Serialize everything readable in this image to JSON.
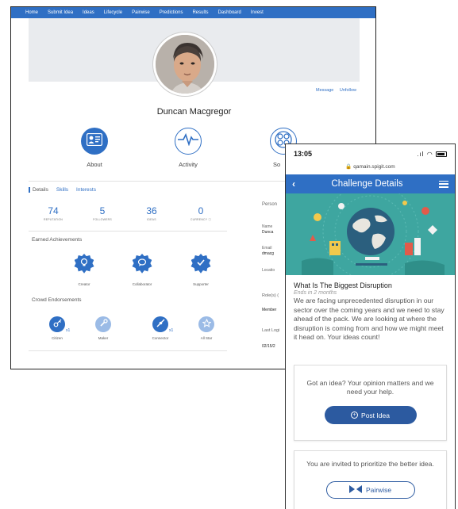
{
  "desktop": {
    "nav": [
      "Home",
      "Submit Idea",
      "Ideas",
      "Lifecycle",
      "Pairwise",
      "Predictions",
      "Results",
      "Dashboard",
      "Invest"
    ],
    "profile": {
      "name": "Duncan Macgregor",
      "message_label": "Message",
      "unfollow_label": "Unfollow"
    },
    "big_tabs": [
      {
        "label": "About",
        "icon": "id-card-icon"
      },
      {
        "label": "Activity",
        "icon": "activity-pulse-icon"
      },
      {
        "label": "So",
        "icon": "social-network-icon"
      }
    ],
    "detail_tabs": [
      "Details",
      "Skills",
      "Interests"
    ],
    "stats": [
      {
        "value": "74",
        "label": "REPUTATION"
      },
      {
        "value": "5",
        "label": "FOLLOWERS"
      },
      {
        "value": "36",
        "label": "IDEAS"
      },
      {
        "value": "0",
        "label": "CURRENCY ⓘ"
      }
    ],
    "achievements_title": "Earned Achievements",
    "achievements": [
      {
        "label": "Creator",
        "icon": "lightbulb-icon"
      },
      {
        "label": "Collaborator",
        "icon": "chat-bubble-icon"
      },
      {
        "label": "Supporter",
        "icon": "checkmark-icon"
      }
    ],
    "endorsements_title": "Crowd Endorsements",
    "endorsements": [
      {
        "label": "Citizen",
        "count": "x1",
        "icon": "key-icon"
      },
      {
        "label": "Maker",
        "count": "",
        "icon": "wrench-icon"
      },
      {
        "label": "Connector",
        "count": "x1",
        "icon": "connector-icon"
      },
      {
        "label": "All Star",
        "count": "",
        "icon": "star-icon"
      }
    ],
    "right_col": {
      "personal": "Person",
      "name_label": "Name",
      "name_value": "Dunca",
      "email_label": "Email",
      "email_value": "dmacg",
      "location_label": "Locatio",
      "roles_label": "Role(s) (",
      "roles_value": "Member",
      "last_login_label": "Last Logi",
      "last_login_value": "02/15/2"
    }
  },
  "phone": {
    "time": "13:05",
    "url": "🔒 qamain.spigit.com",
    "header_title": "Challenge Details",
    "challenge_title": "What Is The Biggest Disruption",
    "ends": "Ends in 2 months",
    "description": "We are facing unprecedented disruption in our sector over the coming years and we need to stay ahead of the pack. We are looking at where the disruption is coming from and how we might meet it head on. Your ideas count!",
    "idea_card": {
      "text": "Got an idea? Your opinion matters and we need your help.",
      "button": "Post Idea"
    },
    "pairwise_card": {
      "text": "You are invited to prioritize the better idea.",
      "button": "Pairwise"
    }
  },
  "colors": {
    "brand_blue": "#2f6fc4",
    "button_blue": "#2c5aa0",
    "hero_teal": "#3ea6a0"
  }
}
